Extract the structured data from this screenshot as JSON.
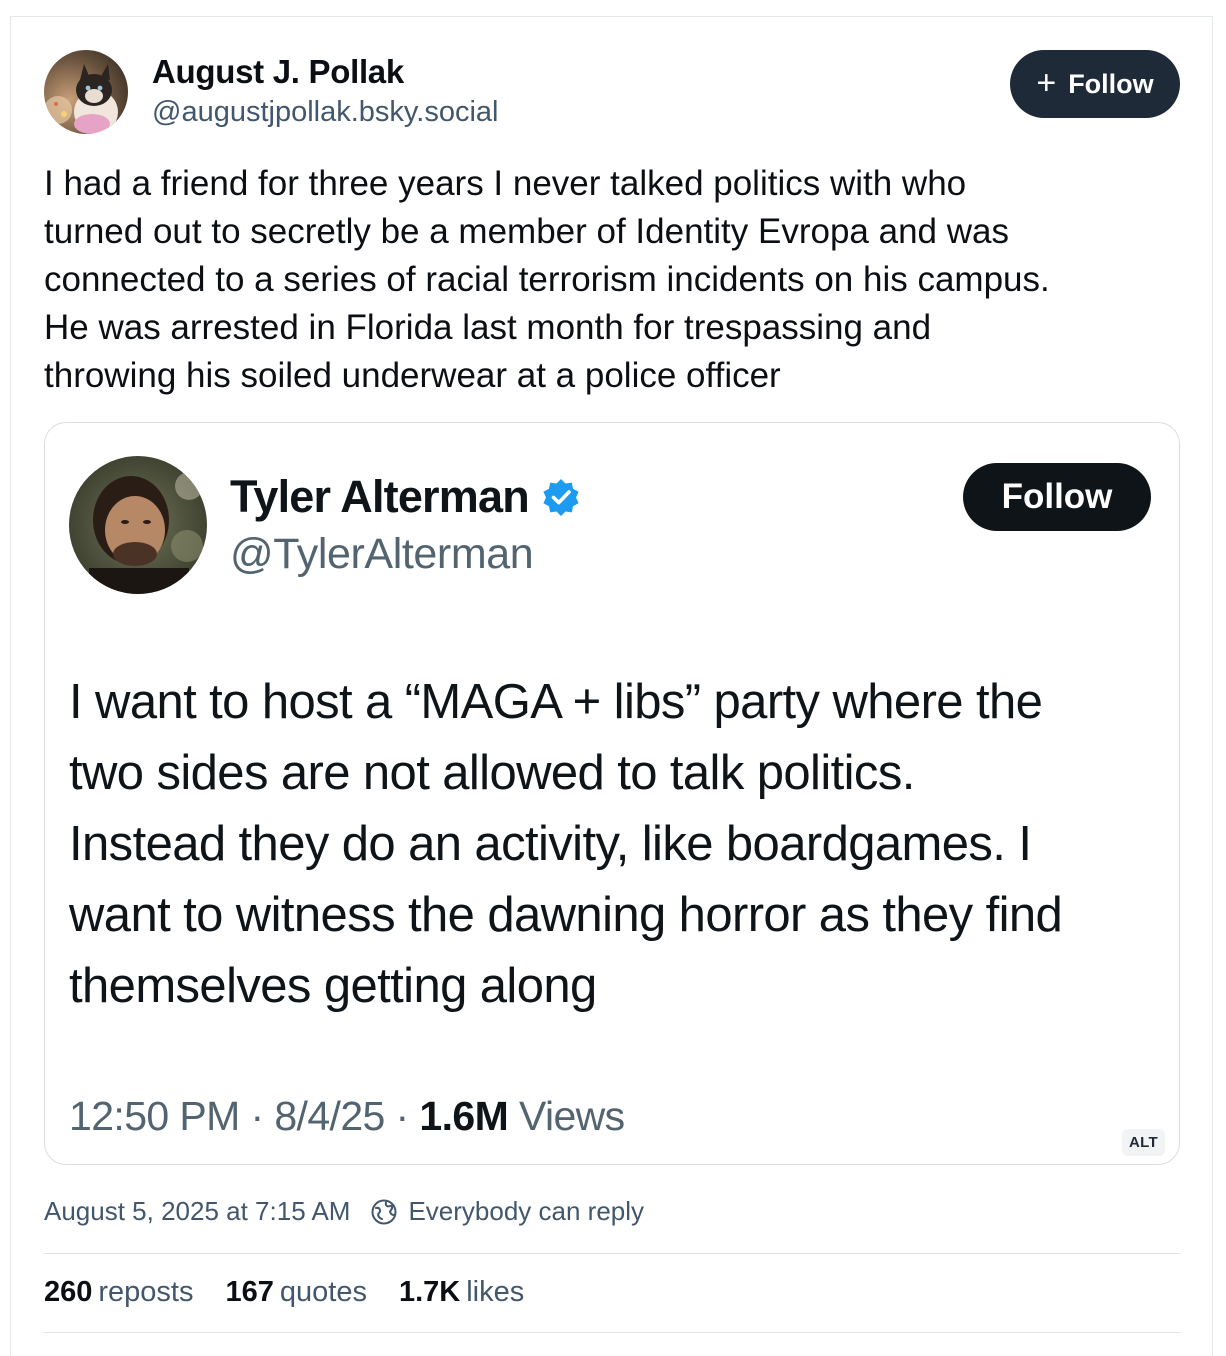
{
  "post": {
    "author_name": "August J. Pollak",
    "author_handle": "@augustjpollak.bsky.social",
    "follow_label": "Follow",
    "text": "I had a friend for three years I never talked politics with who\nturned out to secretly be a member of Identity Evropa and was\nconnected to a series of racial terrorism incidents on his campus.\nHe was arrested in Florida last month for trespassing and\nthrowing his soiled underwear at a police officer",
    "timestamp": "August 5, 2025 at 7:15 AM",
    "reply_setting": "Everybody can reply",
    "stats": [
      {
        "count": "260",
        "label": "reposts"
      },
      {
        "count": "167",
        "label": "quotes"
      },
      {
        "count": "1.7K",
        "label": "likes"
      }
    ]
  },
  "embed": {
    "name": "Tyler Alterman",
    "handle": "@TylerAlterman",
    "follow_label": "Follow",
    "text": "I want to host a “MAGA + libs” party where the\ntwo sides are not allowed to talk politics.\nInstead they do an activity, like boardgames. I\nwant to witness the dawning horror as they find\nthemselves getting along",
    "time": "12:50 PM",
    "date": "8/4/25",
    "views_count": "1.6M",
    "views_label": "Views",
    "alt_label": "ALT"
  },
  "colors": {
    "follow_button_bg": "#1e2a37",
    "verified_blue": "#1d9bf0",
    "muted_text": "#42576c"
  },
  "icons": {
    "plus": "plus-icon",
    "verified": "verified-badge-icon",
    "reply_setting": "globe-reply-icon"
  }
}
